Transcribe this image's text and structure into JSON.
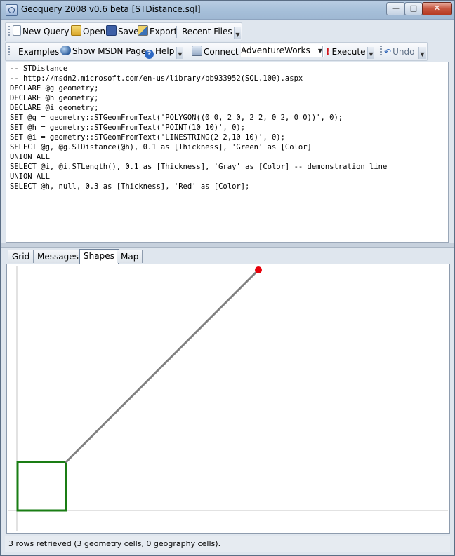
{
  "window": {
    "title": "Geoquery 2008 v0.6 beta [STDistance.sql]"
  },
  "toolbar1": {
    "new_query": "New Query",
    "open": "Open",
    "save": "Save",
    "export": "Export",
    "recent_files": "Recent Files"
  },
  "toolbar2": {
    "examples": "Examples",
    "show_msdn": "Show MSDN Page",
    "help": "Help",
    "connect": "Connect",
    "database": "AdventureWorks",
    "execute": "Execute",
    "undo": "Undo"
  },
  "editor": {
    "lines": [
      "-- STDistance",
      "-- http://msdn2.microsoft.com/en-us/library/bb933952(SQL.100).aspx",
      "DECLARE @g geometry;",
      "DECLARE @h geometry;",
      "DECLARE @i geometry;",
      "SET @g = geometry::STGeomFromText('POLYGON((0 0, 2 0, 2 2, 0 2, 0 0))', 0);",
      "SET @h = geometry::STGeomFromText('POINT(10 10)', 0);",
      "SET @i = geometry::STGeomFromText('LINESTRING(2 2,10 10)', 0);",
      "SELECT @g, @g.STDistance(@h), 0.1 as [Thickness], 'Green' as [Color]",
      "UNION ALL",
      "SELECT @i, @i.STLength(), 0.1 as [Thickness], 'Gray' as [Color] -- demonstration line",
      "UNION ALL",
      "SELECT @h, null, 0.3 as [Thickness], 'Red' as [Color];"
    ]
  },
  "tabs": [
    "Grid",
    "Messages",
    "Shapes",
    "Map"
  ],
  "active_tab": "Shapes",
  "shapes": {
    "polygon": {
      "points": [
        [
          0,
          0
        ],
        [
          2,
          0
        ],
        [
          2,
          2
        ],
        [
          0,
          2
        ],
        [
          0,
          0
        ]
      ],
      "color": "#1a7d14"
    },
    "line": {
      "points": [
        [
          2,
          2
        ],
        [
          10,
          10
        ]
      ],
      "color": "#808080"
    },
    "point": {
      "x": 10,
      "y": 10,
      "color": "#e8000b"
    }
  },
  "status": "3 rows retrieved (3 geometry cells, 0 geography cells)."
}
